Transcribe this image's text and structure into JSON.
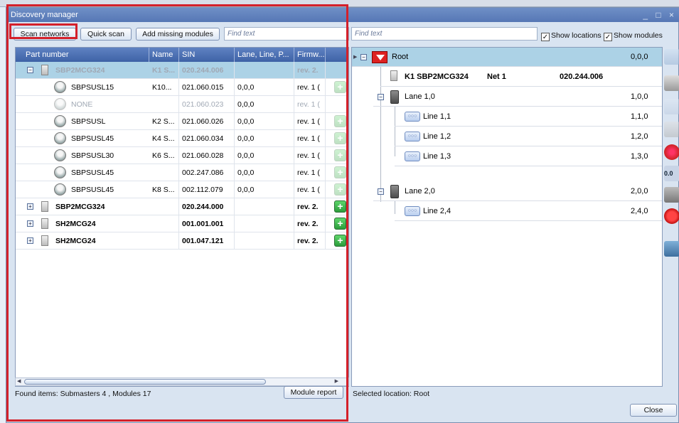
{
  "window": {
    "title": "Discovery manager",
    "controls": "_ □ ×"
  },
  "toolbar": {
    "scan_networks": "Scan networks",
    "quick_scan": "Quick scan",
    "add_missing": "Add missing modules",
    "find_text_left": "Find text",
    "find_text_right": "Find text",
    "show_locations": "Show locations",
    "show_modules": "Show modules",
    "check_mark": "✓"
  },
  "grid": {
    "columns": [
      "Part number",
      "Name",
      "SIN",
      "Lane, Line, P...",
      "Firmw..."
    ],
    "rows": [
      {
        "part": "SBP2MCG324",
        "name": "K1 S...",
        "sin": "020.244.006",
        "lane": "",
        "fw": "rev. 2."
      },
      {
        "part": "SBPSUSL15",
        "name": "K10...",
        "sin": "021.060.015",
        "lane": "0,0,0",
        "fw": "rev. 1 ("
      },
      {
        "part": "NONE",
        "name": "",
        "sin": "021.060.023",
        "lane": "0,0,0",
        "fw": "rev. 1 ("
      },
      {
        "part": "SBPSUSL",
        "name": "K2 S...",
        "sin": "021.060.026",
        "lane": "0,0,0",
        "fw": "rev. 1 ("
      },
      {
        "part": "SBPSUSL45",
        "name": "K4 S...",
        "sin": "021.060.034",
        "lane": "0,0,0",
        "fw": "rev. 1 ("
      },
      {
        "part": "SBPSUSL30",
        "name": "K6 S...",
        "sin": "021.060.028",
        "lane": "0,0,0",
        "fw": "rev. 1 ("
      },
      {
        "part": "SBPSUSL45",
        "name": "",
        "sin": "002.247.086",
        "lane": "0,0,0",
        "fw": "rev. 1 ("
      },
      {
        "part": "SBPSUSL45",
        "name": "K8 S...",
        "sin": "002.112.079",
        "lane": "0,0,0",
        "fw": "rev. 1 ("
      },
      {
        "part": "SBP2MCG324",
        "name": "",
        "sin": "020.244.000",
        "lane": "",
        "fw": "rev. 2."
      },
      {
        "part": "SH2MCG24",
        "name": "",
        "sin": "001.001.001",
        "lane": "",
        "fw": "rev. 2."
      },
      {
        "part": "SH2MCG24",
        "name": "",
        "sin": "001.047.121",
        "lane": "",
        "fw": "rev. 2."
      }
    ]
  },
  "status_left": "Found items: Submasters 4 , Modules 17",
  "module_report": "Module report",
  "status_right": "Selected location: Root",
  "close": "Close",
  "tree": {
    "root": {
      "label": "Root",
      "value": "0,0,0"
    },
    "module": {
      "label": "K1 SBP2MCG324",
      "net": "Net 1",
      "sin": "020.244.006"
    },
    "lane1": {
      "label": "Lane 1,0",
      "value": "1,0,0"
    },
    "line11": {
      "label": "Line 1,1",
      "value": "1,1,0"
    },
    "line12": {
      "label": "Line 1,2",
      "value": "1,2,0"
    },
    "line13": {
      "label": "Line 1,3",
      "value": "1,3,0"
    },
    "lane2": {
      "label": "Lane 2,0",
      "value": "2,0,0"
    },
    "line24": {
      "label": "Line 2,4",
      "value": "2,4,0"
    }
  },
  "colors": {
    "accent": "#d4202a",
    "selection": "#acd2e6",
    "header": "#4a6db0"
  }
}
